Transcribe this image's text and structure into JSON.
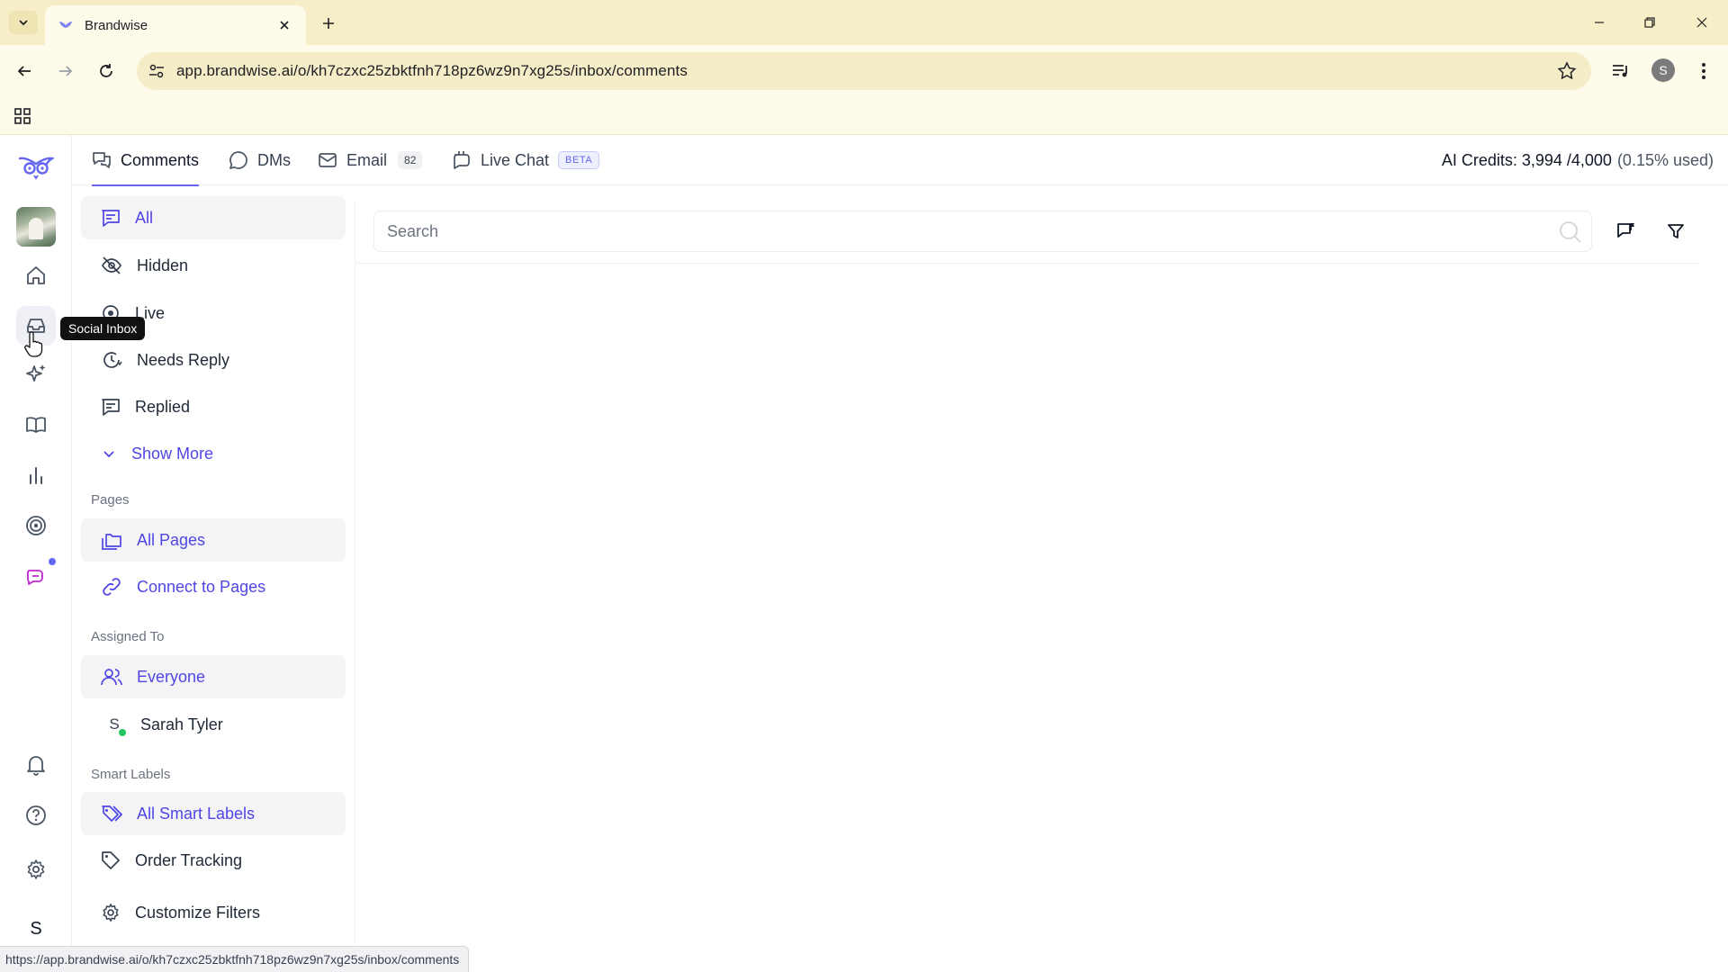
{
  "browser": {
    "tab_title": "Brandwise",
    "url": "app.brandwise.ai/o/kh7czxc25zbktfnh718pz6wz9n7xg25s/inbox/comments",
    "profile_initial": "S",
    "status_url": "https://app.brandwise.ai/o/kh7czxc25zbktfnh718pz6wz9n7xg25s/inbox/comments"
  },
  "rail": {
    "tooltip": "Social Inbox",
    "user_initial": "S"
  },
  "topbar": {
    "tabs": [
      {
        "label": "Comments"
      },
      {
        "label": "DMs"
      },
      {
        "label": "Email",
        "count": "82"
      },
      {
        "label": "Live Chat",
        "badge": "BETA"
      }
    ],
    "credits": "AI Credits: 3,994 /4,000",
    "credits_used": "(0.15% used)"
  },
  "filters": {
    "status_items": [
      "All",
      "Hidden",
      "Live",
      "Needs Reply",
      "Replied"
    ],
    "show_more": "Show More",
    "pages_heading": "Pages",
    "pages_items": [
      "All Pages",
      "Connect to Pages"
    ],
    "assigned_heading": "Assigned To",
    "assigned_items": [
      "Everyone",
      "Sarah Tyler"
    ],
    "assignee_initial": "S",
    "labels_heading": "Smart Labels",
    "labels_items": [
      "All Smart Labels",
      "Order Tracking"
    ],
    "customize": "Customize Filters"
  },
  "main": {
    "search_placeholder": "Search"
  },
  "colors": {
    "accent": "#6366f1",
    "online": "#22c55e",
    "chrome": "#fffbeb"
  }
}
